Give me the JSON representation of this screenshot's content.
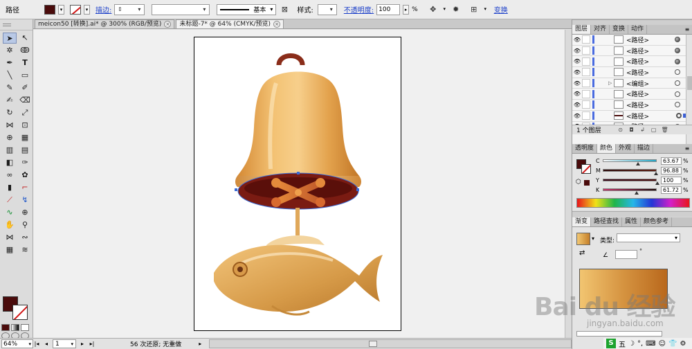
{
  "control_bar": {
    "object_type": "路径",
    "stroke_label": "描边:",
    "brush_label": "基本",
    "style_label": "样式:",
    "opacity_label": "不透明度:",
    "opacity_value": "100",
    "opacity_unit": "%",
    "transform_label": "变换",
    "fill_color": "#4a0b0b"
  },
  "tabs": [
    {
      "label": "meicon50 [转换].ai* @ 300% (RGB/预览)",
      "active": false
    },
    {
      "label": "未标题-7* @ 64% (CMYK/预览)",
      "active": true
    }
  ],
  "status": {
    "zoom": "64%",
    "page": "1",
    "history": "56 次还原; 无重做"
  },
  "layers_panel": {
    "tabs": [
      "图层",
      "对齐",
      "变换",
      "动作"
    ],
    "rows": [
      {
        "name": "<路径>",
        "target": "filled"
      },
      {
        "name": "<路径>",
        "target": "filled"
      },
      {
        "name": "<路径>",
        "target": "filled"
      },
      {
        "name": "<路径>",
        "target": "empty"
      },
      {
        "name": "<编组>",
        "target": "empty",
        "expandable": true
      },
      {
        "name": "<路径>",
        "target": "empty"
      },
      {
        "name": "<路径>",
        "target": "empty"
      },
      {
        "name": "<路径>",
        "target": "selected"
      },
      {
        "name": "<路径>",
        "target": "filled"
      }
    ],
    "footer": "1 个图层"
  },
  "color_panel": {
    "tabs": [
      "透明度",
      "颜色",
      "外观",
      "描边"
    ],
    "active_tab": "颜色",
    "channels": [
      {
        "key": "C",
        "value": "63.67",
        "pos": 0.64,
        "color": "#1fa8c9"
      },
      {
        "key": "M",
        "value": "96.88",
        "pos": 0.97,
        "color": "#c8168c"
      },
      {
        "key": "Y",
        "value": "100",
        "pos": 1.0,
        "color": "#e3c412"
      },
      {
        "key": "K",
        "value": "61.72",
        "pos": 0.62,
        "color": "#333333"
      }
    ],
    "unit": "%"
  },
  "gradient_panel": {
    "tabs": [
      "渐变",
      "路径查找",
      "属性",
      "颜色参考"
    ],
    "type_label": "类型:",
    "angle_symbol": "°",
    "start_color": "#f3c873",
    "end_color": "#b9681c"
  },
  "watermark": {
    "text": "Bai du 经验",
    "url": "jingyan.baidu.com"
  },
  "tray": {
    "ime": "五",
    "badge": "S"
  }
}
